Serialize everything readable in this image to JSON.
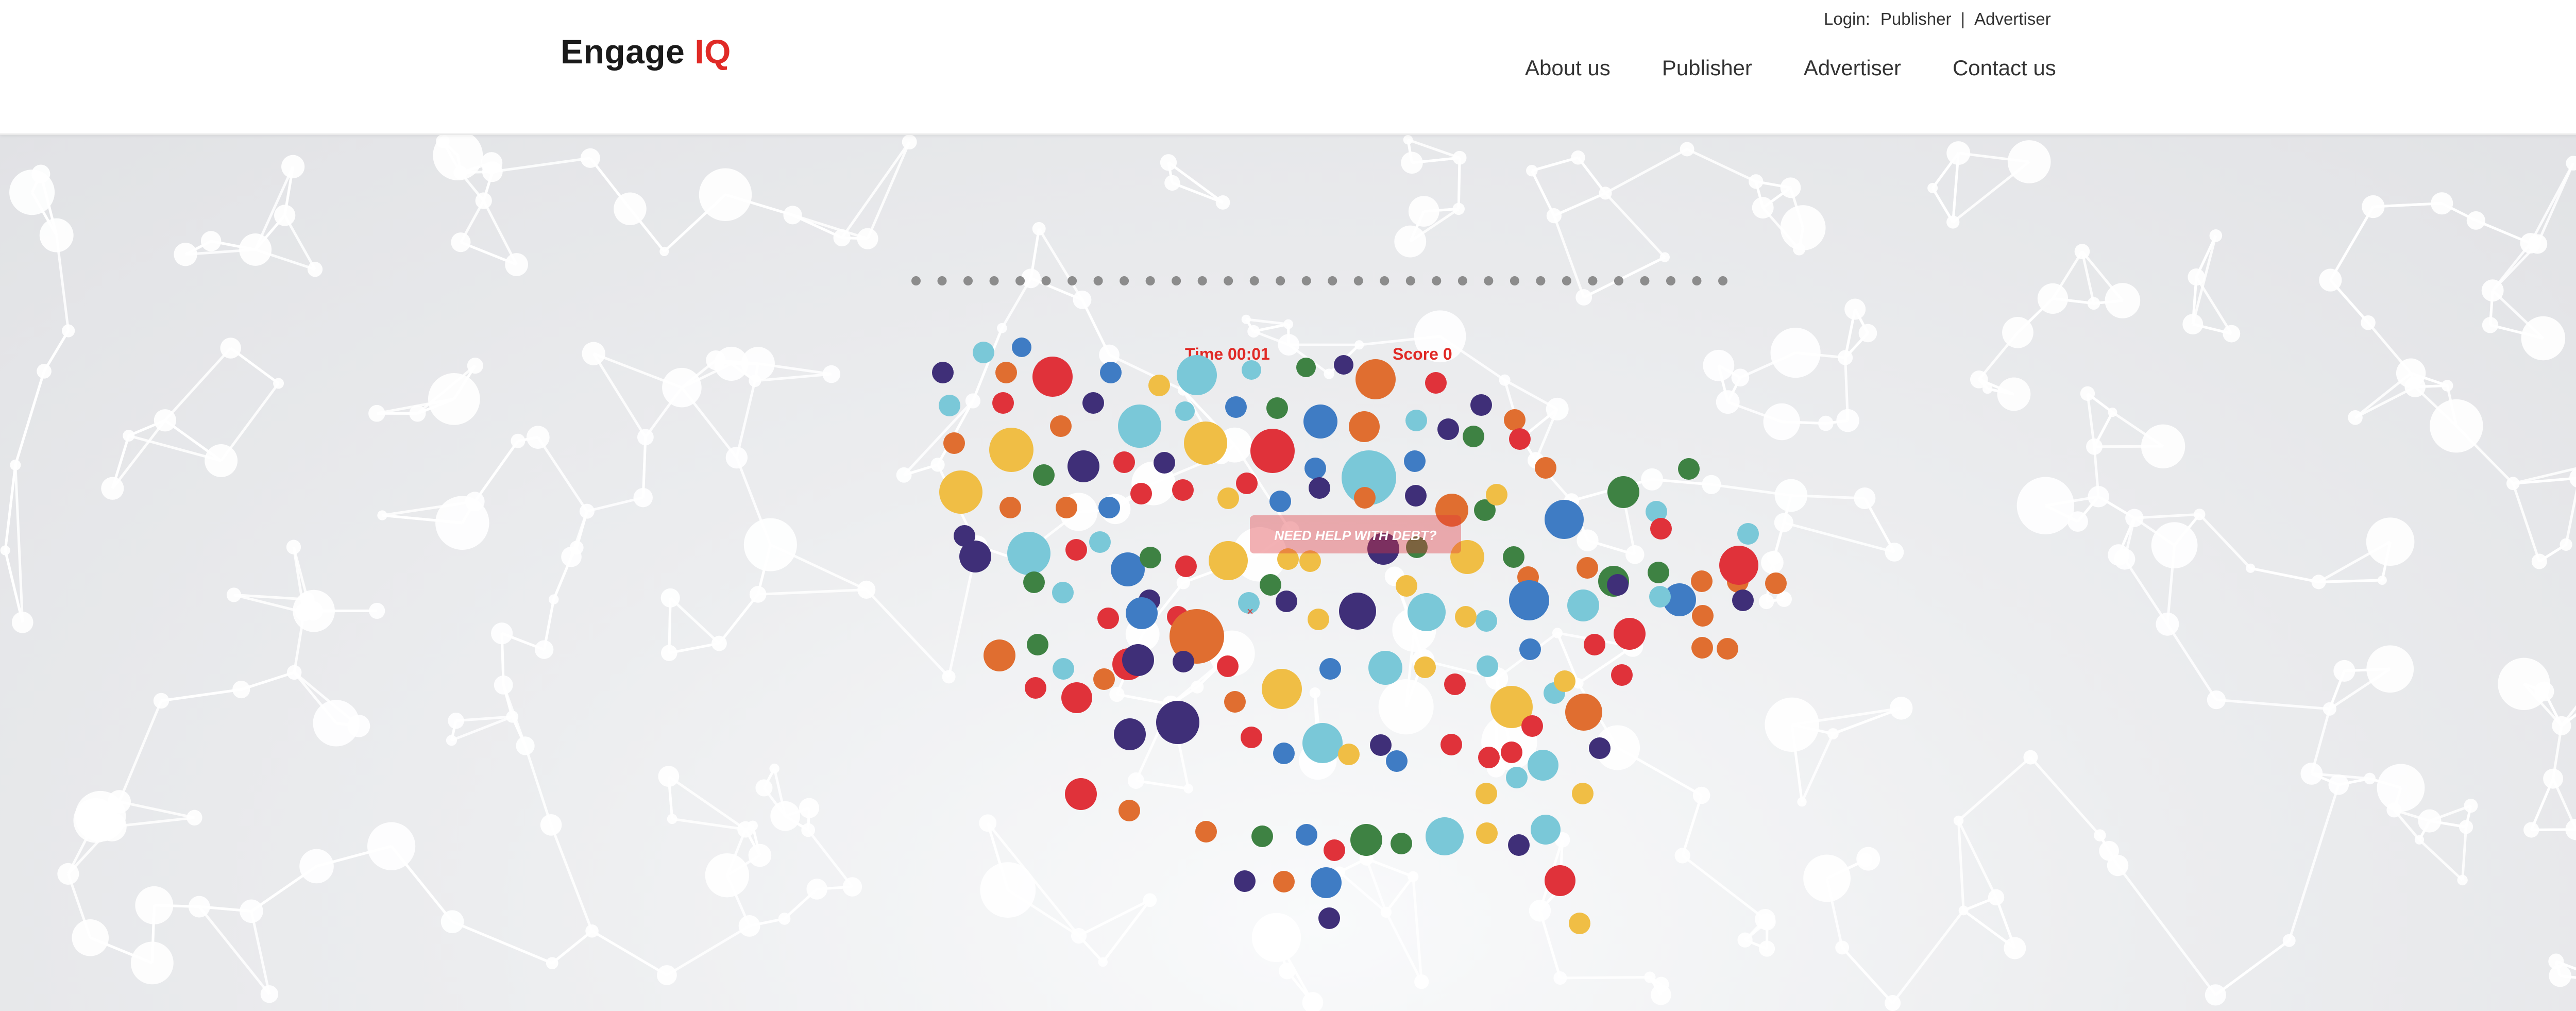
{
  "header": {
    "logo_main": "Engage ",
    "logo_accent": "IQ",
    "login": {
      "label": "Login:",
      "publisher": "Publisher",
      "separator": "|",
      "advertiser": "Advertiser"
    },
    "nav": [
      {
        "label": "About us"
      },
      {
        "label": "Publisher"
      },
      {
        "label": "Advertiser"
      },
      {
        "label": "Contact us"
      }
    ]
  },
  "game": {
    "time_label": "Time 00:01",
    "score_label": "Score 0",
    "popup_text": "NEED HELP WITH DEBT?",
    "progress_dots_total": 32
  },
  "colors": {
    "brand_red": "#e02a26",
    "bubble_palette": [
      "#e0323a",
      "#e06e30",
      "#f0be45",
      "#7ac8d8",
      "#3f7cc4",
      "#3f2f78",
      "#3e8243"
    ]
  }
}
